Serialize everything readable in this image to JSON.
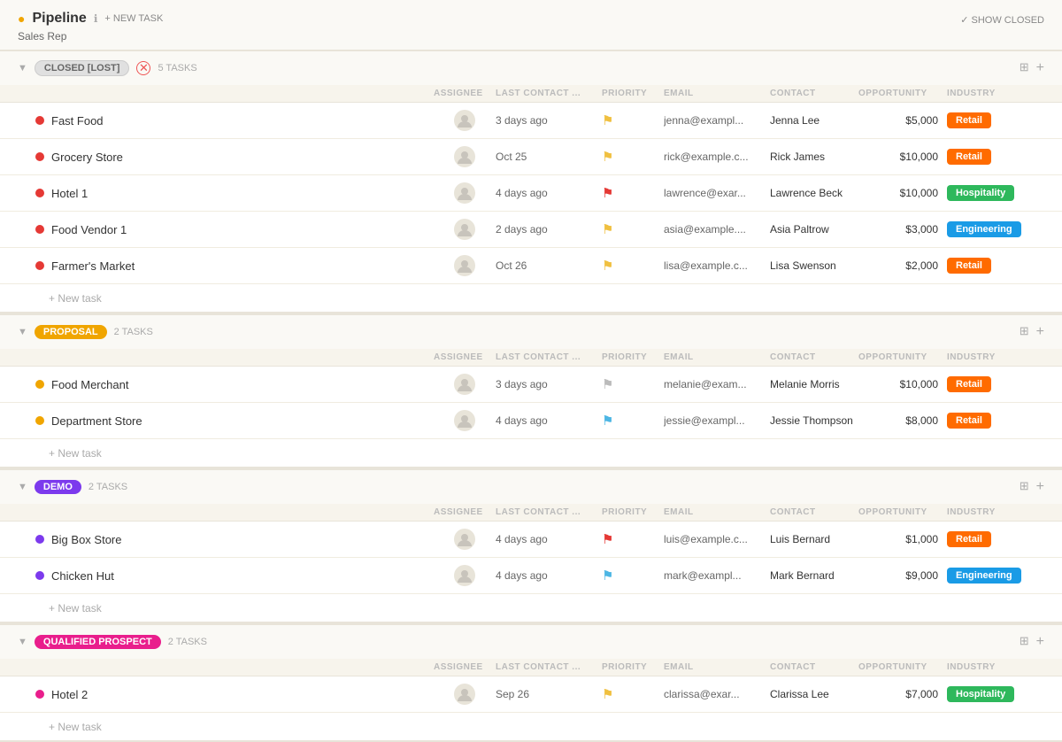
{
  "header": {
    "title": "Pipeline",
    "new_task_label": "+ NEW TASK",
    "show_closed_label": "✓ SHOW CLOSED",
    "subtitle": "Sales Rep"
  },
  "columns": {
    "assignee": "ASSIGNEE",
    "last_contact": "LAST CONTACT ...",
    "priority": "PRIORITY",
    "email": "EMAIL",
    "contact": "CONTACT",
    "opportunity": "OPPORTUNITY",
    "industry": "INDUSTRY"
  },
  "sections": [
    {
      "id": "closed-lost",
      "badge_label": "CLOSED [LOST]",
      "badge_type": "closed-lost",
      "task_count": "5 TASKS",
      "rows": [
        {
          "name": "Fast Food",
          "dot": "red",
          "last_contact": "3 days ago",
          "priority": "yellow",
          "email": "jenna@exampl...",
          "contact": "Jenna Lee",
          "opportunity": "$5,000",
          "industry": "Retail",
          "industry_type": "retail"
        },
        {
          "name": "Grocery Store",
          "dot": "red",
          "last_contact": "Oct 25",
          "priority": "yellow",
          "email": "rick@example.c...",
          "contact": "Rick James",
          "opportunity": "$10,000",
          "industry": "Retail",
          "industry_type": "retail"
        },
        {
          "name": "Hotel 1",
          "dot": "red",
          "last_contact": "4 days ago",
          "priority": "red",
          "email": "lawrence@exar...",
          "contact": "Lawrence Beck",
          "opportunity": "$10,000",
          "industry": "Hospitality",
          "industry_type": "hospitality"
        },
        {
          "name": "Food Vendor 1",
          "dot": "red",
          "last_contact": "2 days ago",
          "priority": "yellow",
          "email": "asia@example....",
          "contact": "Asia Paltrow",
          "opportunity": "$3,000",
          "industry": "Engineering",
          "industry_type": "engineering"
        },
        {
          "name": "Farmer's Market",
          "dot": "red",
          "last_contact": "Oct 26",
          "priority": "yellow",
          "email": "lisa@example.c...",
          "contact": "Lisa Swenson",
          "opportunity": "$2,000",
          "industry": "Retail",
          "industry_type": "retail"
        }
      ],
      "new_task_label": "+ New task"
    },
    {
      "id": "proposal",
      "badge_label": "PROPOSAL",
      "badge_type": "proposal",
      "task_count": "2 TASKS",
      "rows": [
        {
          "name": "Food Merchant",
          "dot": "yellow",
          "last_contact": "3 days ago",
          "priority": "gray",
          "email": "melanie@exam...",
          "contact": "Melanie Morris",
          "opportunity": "$10,000",
          "industry": "Retail",
          "industry_type": "retail"
        },
        {
          "name": "Department Store",
          "dot": "yellow",
          "last_contact": "4 days ago",
          "priority": "blue",
          "email": "jessie@exampl...",
          "contact": "Jessie Thompson",
          "opportunity": "$8,000",
          "industry": "Retail",
          "industry_type": "retail"
        }
      ],
      "new_task_label": "+ New task"
    },
    {
      "id": "demo",
      "badge_label": "DEMO",
      "badge_type": "demo",
      "task_count": "2 TASKS",
      "rows": [
        {
          "name": "Big Box Store",
          "dot": "purple",
          "last_contact": "4 days ago",
          "priority": "red",
          "email": "luis@example.c...",
          "contact": "Luis Bernard",
          "opportunity": "$1,000",
          "industry": "Retail",
          "industry_type": "retail"
        },
        {
          "name": "Chicken Hut",
          "dot": "purple",
          "last_contact": "4 days ago",
          "priority": "blue",
          "email": "mark@exampl...",
          "contact": "Mark Bernard",
          "opportunity": "$9,000",
          "industry": "Engineering",
          "industry_type": "engineering"
        }
      ],
      "new_task_label": "+ New task"
    },
    {
      "id": "qualified-prospect",
      "badge_label": "QUALIFIED PROSPECT",
      "badge_type": "qualified",
      "task_count": "2 TASKS",
      "rows": [
        {
          "name": "Hotel 2",
          "dot": "pink",
          "last_contact": "Sep 26",
          "priority": "yellow",
          "email": "clarissa@exar...",
          "contact": "Clarissa Lee",
          "opportunity": "$7,000",
          "industry": "Hospitality",
          "industry_type": "hospitality"
        }
      ],
      "new_task_label": "+ New task"
    }
  ]
}
